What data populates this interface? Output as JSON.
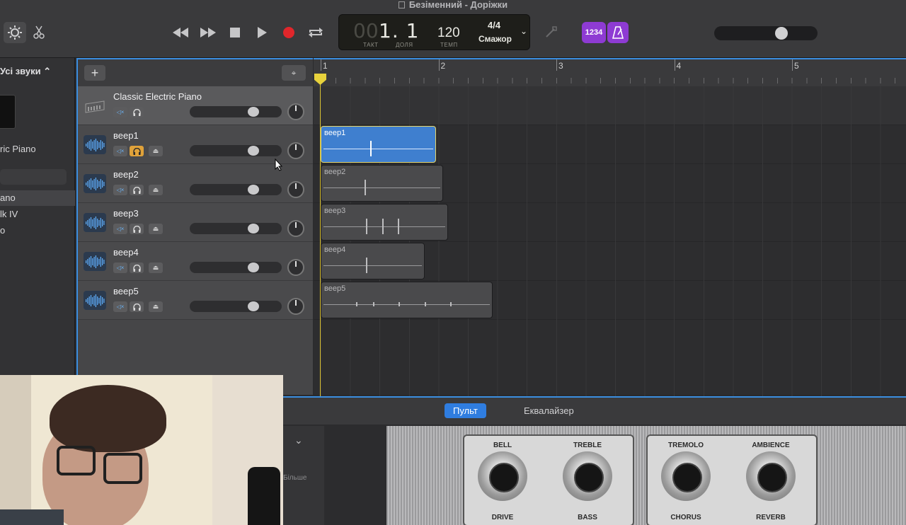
{
  "window": {
    "title": "Безіменний - Доріжки"
  },
  "toolbar": {
    "lcd": {
      "position_dim": "00",
      "position": "1. 1",
      "bar_label": "ТАКТ",
      "beat_label": "ДОЛЯ",
      "tempo": "120",
      "tempo_label": "ТЕМП",
      "signature": "4/4",
      "key": "Cмажор"
    },
    "count_in_label": "1234",
    "master_volume_percent": 68
  },
  "library": {
    "header": "Усі звуки",
    "instrument_name": "ric Piano",
    "items": [
      "ano",
      "lk IV",
      "o"
    ]
  },
  "tracks": [
    {
      "name": "Classic Electric Piano",
      "type": "instrument",
      "solo": false,
      "volume_percent": 72
    },
    {
      "name": "веер1",
      "type": "audio",
      "solo": true,
      "volume_percent": 72
    },
    {
      "name": "веер2",
      "type": "audio",
      "solo": false,
      "volume_percent": 72
    },
    {
      "name": "веер3",
      "type": "audio",
      "solo": false,
      "volume_percent": 72
    },
    {
      "name": "веер4",
      "type": "audio",
      "solo": false,
      "volume_percent": 72
    },
    {
      "name": "веер5",
      "type": "audio",
      "solo": false,
      "volume_percent": 72
    }
  ],
  "ruler": {
    "bars": [
      "1",
      "2",
      "3",
      "4",
      "5"
    ]
  },
  "regions": [
    {
      "name": "веер1",
      "lane": 1,
      "start_bar": 1.0,
      "end_bar": 1.98,
      "selected": true
    },
    {
      "name": "веер2",
      "lane": 2,
      "start_bar": 1.0,
      "end_bar": 2.04,
      "selected": false
    },
    {
      "name": "веер3",
      "lane": 3,
      "start_bar": 1.0,
      "end_bar": 2.08,
      "selected": false
    },
    {
      "name": "веер4",
      "lane": 4,
      "start_bar": 1.0,
      "end_bar": 1.88,
      "selected": false
    },
    {
      "name": "веер5",
      "lane": 5,
      "start_bar": 1.0,
      "end_bar": 2.46,
      "selected": false
    }
  ],
  "editor": {
    "tabs": [
      {
        "label": "Пульт",
        "active": true
      },
      {
        "label": "Еквалайзер",
        "active": false
      }
    ],
    "more_label": "Більше",
    "knobs_top": [
      "BELL",
      "TREBLE",
      "TREMOLO",
      "AMBIENCE"
    ],
    "knobs_bottom": [
      "DRIVE",
      "BASS",
      "CHORUS",
      "REVERB"
    ]
  }
}
